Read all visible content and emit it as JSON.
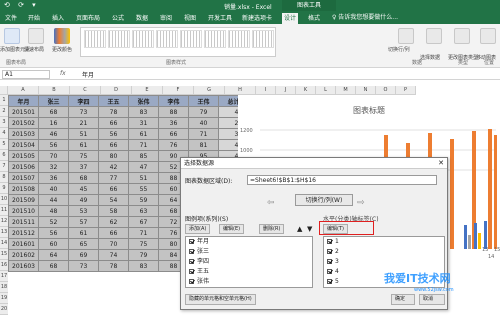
{
  "window": {
    "filename": "销量.xlsx - Excel",
    "chart_tools": "图表工具",
    "quick_access": "⟲ ⟳ ▾"
  },
  "tabs": [
    "文件",
    "开始",
    "插入",
    "页面布局",
    "公式",
    "数据",
    "审阅",
    "视图",
    "开发工具",
    "新建选项卡",
    "设计",
    "格式"
  ],
  "tell_me": "♀ 告诉我您想要做什么...",
  "ribbon": {
    "buttons": [
      "添加图表元素",
      "快速布局",
      "更改颜色"
    ],
    "right_buttons": [
      "切换行/列",
      "选择数据",
      "更改图表类型",
      "移动图表"
    ],
    "groups": [
      "图表布局",
      "图表样式",
      "数据",
      "类型",
      "位置"
    ]
  },
  "formula": {
    "namebox": "A1",
    "fx": "fx",
    "value": "年月"
  },
  "columns": [
    "A",
    "B",
    "C",
    "D",
    "E",
    "F",
    "G",
    "H",
    "I",
    "J",
    "K",
    "L",
    "M",
    "N",
    "O",
    "P"
  ],
  "rows": [
    "1",
    "2",
    "3",
    "4",
    "5",
    "6",
    "7",
    "8",
    "9",
    "10",
    "11",
    "12",
    "13",
    "14",
    "15",
    "16",
    "17",
    "18",
    "19",
    "20"
  ],
  "table": {
    "headers": [
      "年月",
      "张三",
      "李四",
      "王五",
      "张伟",
      "李伟",
      "王伟",
      "总计"
    ],
    "rows": [
      [
        "201501",
        "68",
        "73",
        "78",
        "83",
        "88",
        "79",
        "469"
      ],
      [
        "201502",
        "16",
        "21",
        "66",
        "31",
        "36",
        "40",
        "210"
      ],
      [
        "201503",
        "46",
        "51",
        "56",
        "61",
        "66",
        "71",
        "351"
      ],
      [
        "201504",
        "56",
        "61",
        "66",
        "71",
        "76",
        "81",
        "411"
      ],
      [
        "201505",
        "70",
        "75",
        "80",
        "85",
        "90",
        "95",
        "423"
      ],
      [
        "201506",
        "32",
        "37",
        "42",
        "47",
        "52",
        "57",
        "267"
      ],
      [
        "201507",
        "36",
        "68",
        "77",
        "51",
        "88",
        "",
        ""
      ],
      [
        "201508",
        "40",
        "45",
        "66",
        "55",
        "60",
        "",
        ""
      ],
      [
        "201509",
        "44",
        "49",
        "54",
        "59",
        "64",
        "",
        ""
      ],
      [
        "201510",
        "48",
        "53",
        "58",
        "63",
        "68",
        "",
        ""
      ],
      [
        "201511",
        "52",
        "57",
        "62",
        "67",
        "72",
        "",
        ""
      ],
      [
        "201512",
        "56",
        "61",
        "66",
        "71",
        "76",
        "",
        ""
      ],
      [
        "201601",
        "60",
        "65",
        "70",
        "75",
        "80",
        "",
        ""
      ],
      [
        "201602",
        "64",
        "69",
        "74",
        "79",
        "84",
        "",
        ""
      ],
      [
        "201603",
        "68",
        "73",
        "78",
        "83",
        "88",
        "",
        ""
      ]
    ]
  },
  "chart": {
    "title": "图表标题",
    "yticks": [
      "1200",
      "1000",
      "800"
    ],
    "xticks": [
      "13",
      "14",
      "15"
    ],
    "colors": {
      "blue": "#4472c4",
      "orange": "#ed7d31",
      "gray": "#a5a5a5",
      "gold": "#ffc000"
    }
  },
  "dialog": {
    "title": "选择数据源",
    "close": "✕",
    "range_label": "图表数据区域(D):",
    "range_value": "=Sheet6!$B$1:$H$16",
    "switch": "切换行/列(W)",
    "series_label": "图例项(系列)(S)",
    "series_add": "添加(A)",
    "series_edit": "编辑(E)",
    "series_delete": "删除(R)",
    "category_label": "水平(分类)轴标签(C)",
    "category_edit": "编辑(T)",
    "series_items": [
      "年月",
      "张三",
      "李四",
      "王五",
      "张伟"
    ],
    "category_items": [
      "1",
      "2",
      "3",
      "4",
      "5"
    ],
    "hidden_cells": "隐藏的单元格和空单元格(H)",
    "ok": "确定",
    "cancel": "取消"
  },
  "watermark": {
    "text": "我爱IT技术网",
    "url": "www.52jsw.com"
  }
}
